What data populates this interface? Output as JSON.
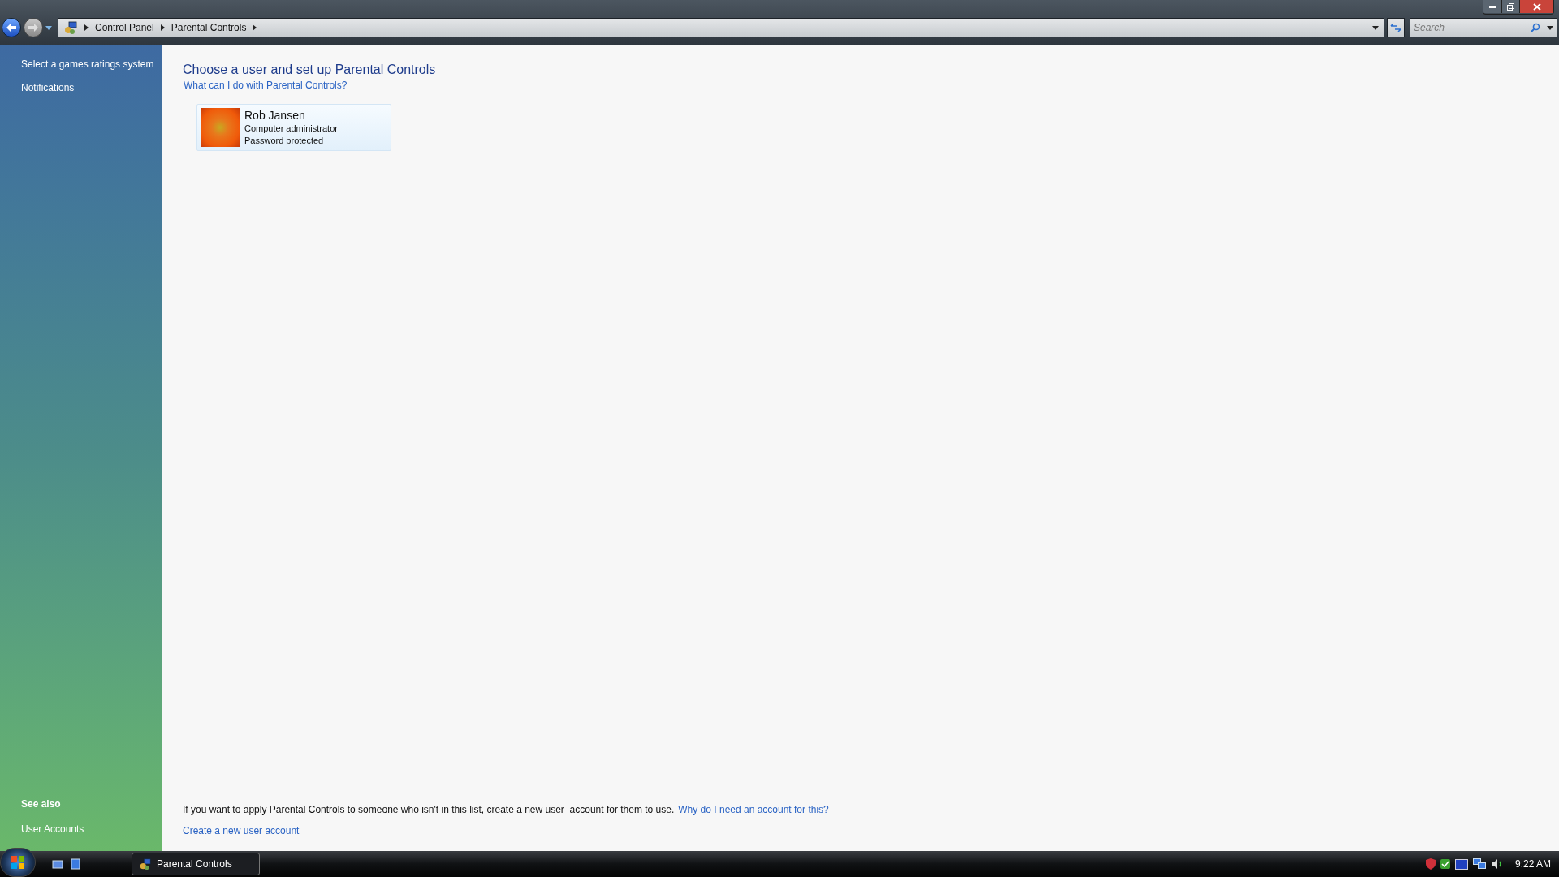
{
  "nav": {
    "breadcrumb": [
      "Control Panel",
      "Parental Controls"
    ],
    "search": {
      "placeholder": "Search"
    }
  },
  "sidebar": {
    "tasks": [
      "Select a games ratings system",
      "Notifications"
    ],
    "see_also": {
      "heading": "See also",
      "links": [
        "User Accounts"
      ]
    }
  },
  "main": {
    "title": "Choose a user and set up Parental Controls",
    "help_link": "What can I do with Parental Controls?",
    "users": [
      {
        "name": "Rob Jansen",
        "role": "Computer administrator",
        "status": "Password protected"
      }
    ],
    "footer": {
      "text": "If you want to apply Parental Controls to someone who isn't in this list, create a new user  account for them to use.",
      "link": "Why do I need an account for this?",
      "create_link": "Create a new user account"
    }
  },
  "taskbar": {
    "windows": [
      {
        "label": "Parental Controls",
        "selected": true
      }
    ],
    "clock": "9:22 AM"
  }
}
